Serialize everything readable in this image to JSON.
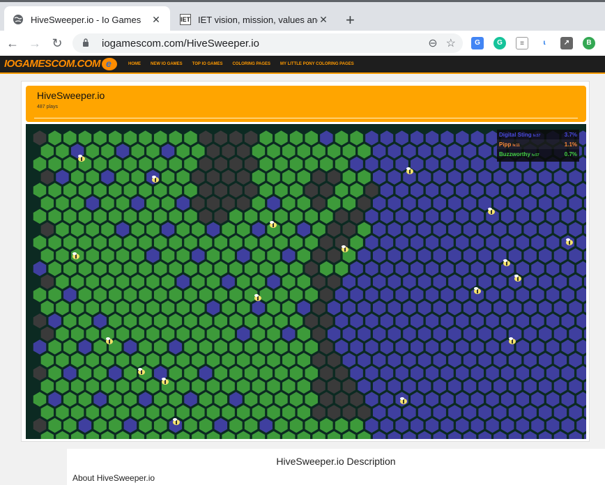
{
  "browser": {
    "tabs": [
      {
        "title": "HiveSweeper.io - Io Games",
        "close": "✕"
      },
      {
        "title": "IET vision, mission, values and be",
        "favicon": "IET",
        "close": "✕"
      }
    ],
    "new_tab": "+",
    "url": "iogamescom.com/HiveSweeper.io"
  },
  "site": {
    "logo": "IOGAMESCOM.COM",
    "nav": [
      "HOME",
      "NEW IO GAMES",
      "TOP IO GAMES",
      "COLORING PAGES",
      "MY LITTLE PONY COLORING PAGES"
    ]
  },
  "game": {
    "title": "HiveSweeper.io",
    "plays": "487 plays"
  },
  "leaderboard": [
    {
      "name": "Digital Sting",
      "level": "lv.57",
      "pct": "3.7%",
      "color": "#4a4ae0"
    },
    {
      "name": "Pipp",
      "level": "lv.11",
      "pct": "1.1%",
      "color": "#ff8a3d"
    },
    {
      "name": "Buzzworthy",
      "level": "lv.57",
      "pct": "0.7%",
      "color": "#44d144"
    }
  ],
  "colors": {
    "green": "#3d9a3a",
    "blue": "#3f3f9f",
    "gray": "#3a3a3a",
    "orange": "#ff7f3f",
    "highlight_green": "#5ab556"
  },
  "description": {
    "title": "HiveSweeper.io Description",
    "subtitle": "About HiveSweeper.io"
  }
}
